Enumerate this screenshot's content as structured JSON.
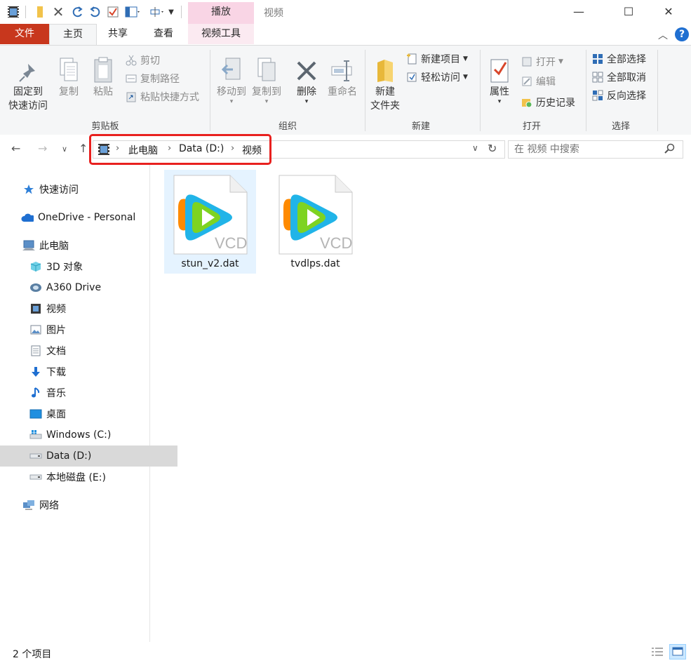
{
  "titlebar": {
    "context_tab": "播放",
    "window_title": "视频",
    "minimize": "—",
    "maximize": "☐",
    "close": "✕"
  },
  "ribbon_tabs": {
    "file": "文件",
    "home": "主页",
    "share": "共享",
    "view": "查看",
    "video_tools": "视频工具"
  },
  "ribbon": {
    "clipboard": {
      "pin_quick_access_line1": "固定到",
      "pin_quick_access_line2": "快速访问",
      "copy": "复制",
      "paste": "粘贴",
      "cut": "剪切",
      "copy_path": "复制路径",
      "paste_shortcut": "粘贴快捷方式",
      "label": "剪贴板"
    },
    "organize": {
      "move_to": "移动到",
      "copy_to": "复制到",
      "delete": "删除",
      "rename": "重命名",
      "label": "组织"
    },
    "new": {
      "new_folder_line1": "新建",
      "new_folder_line2": "文件夹",
      "new_item": "新建项目",
      "easy_access": "轻松访问",
      "label": "新建"
    },
    "open": {
      "properties": "属性",
      "open": "打开",
      "edit": "编辑",
      "history": "历史记录",
      "label": "打开"
    },
    "select": {
      "select_all": "全部选择",
      "select_none": "全部取消",
      "invert": "反向选择",
      "label": "选择"
    }
  },
  "address": {
    "crumbs": [
      "此电脑",
      "Data (D:)",
      "视频"
    ]
  },
  "search": {
    "placeholder": "在 视频 中搜索"
  },
  "nav_pane": {
    "items": [
      {
        "label": "快速访问",
        "icon": "star-icon"
      },
      {
        "label": "OneDrive - Personal",
        "icon": "cloud-icon"
      },
      {
        "label": "此电脑",
        "icon": "computer-icon"
      },
      {
        "label": "3D 对象",
        "icon": "cube-icon"
      },
      {
        "label": "A360 Drive",
        "icon": "a360-icon"
      },
      {
        "label": "视频",
        "icon": "video-folder-icon"
      },
      {
        "label": "图片",
        "icon": "pictures-icon"
      },
      {
        "label": "文档",
        "icon": "documents-icon"
      },
      {
        "label": "下载",
        "icon": "download-icon"
      },
      {
        "label": "音乐",
        "icon": "music-icon"
      },
      {
        "label": "桌面",
        "icon": "desktop-icon"
      },
      {
        "label": "Windows (C:)",
        "icon": "drive-c-icon"
      },
      {
        "label": "Data (D:)",
        "icon": "drive-icon"
      },
      {
        "label": "本地磁盘 (E:)",
        "icon": "drive-icon"
      },
      {
        "label": "网络",
        "icon": "network-icon"
      }
    ]
  },
  "files": [
    {
      "name": "stun_v2.dat",
      "badge": "VCD"
    },
    {
      "name": "tvdlps.dat",
      "badge": "VCD"
    }
  ],
  "status": {
    "item_count": "2 个项目"
  },
  "colors": {
    "file_tab": "#c8371d",
    "context_tab": "#f9d5e5",
    "highlight_box": "#e8211f",
    "selected_file": "#e5f3ff"
  }
}
